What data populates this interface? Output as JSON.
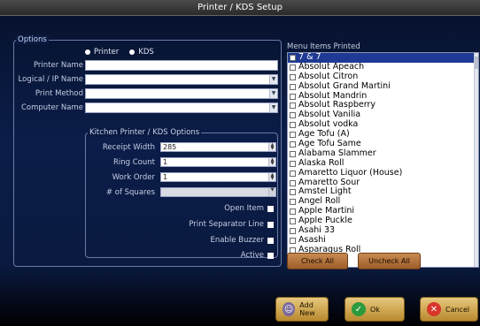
{
  "window": {
    "title": "Printer / KDS Setup"
  },
  "options": {
    "legend": "Options",
    "radio_printer": "Printer",
    "radio_kds": "KDS",
    "printer_name_label": "Printer Name",
    "logical_ip_label": "Logical / IP Name",
    "print_method_label": "Print Method",
    "computer_name_label": "Computer Name"
  },
  "kitchen": {
    "legend": "Kitchen Printer / KDS Options",
    "receipt_width_label": "Receipt Width",
    "receipt_width_value": "285",
    "ring_count_label": "Ring Count",
    "ring_count_value": "1",
    "work_order_label": "Work Order",
    "work_order_value": "1",
    "squares_label": "# of Squares",
    "open_item_label": "Open Item",
    "print_separator_label": "Print Separator Line",
    "enable_buzzer_label": "Enable Buzzer",
    "active_label": "Active"
  },
  "menu": {
    "title": "Menu Items Printed",
    "items": [
      "7 & 7",
      "Absolut Apeach",
      "Absolut Citron",
      "Absolut Grand Martini",
      "Absolut Mandrin",
      "Absolut Raspberry",
      "Absolut Vanilia",
      "Absolut vodka",
      "Age Tofu (A)",
      "Age Tofu Same",
      "Alabama Slammer",
      "Alaska Roll",
      "Amaretto Liquor (House)",
      "Amaretto Sour",
      "Amstel Light",
      "Angel Roll",
      "Apple Martini",
      "Apple Puckle",
      "Asahi 33",
      "Asashi",
      "Asparagus Roll"
    ],
    "check_all_label": "Check All",
    "uncheck_all_label": "Uncheck All"
  },
  "actions": {
    "add_new_label": "Add New",
    "ok_label": "Ok",
    "cancel_label": "Cancel"
  },
  "colors": {
    "background_top": "#07122e",
    "selected_item": "#1f3a94",
    "button_brown": "#b0703a",
    "button_gold": "#d4ad5a"
  }
}
